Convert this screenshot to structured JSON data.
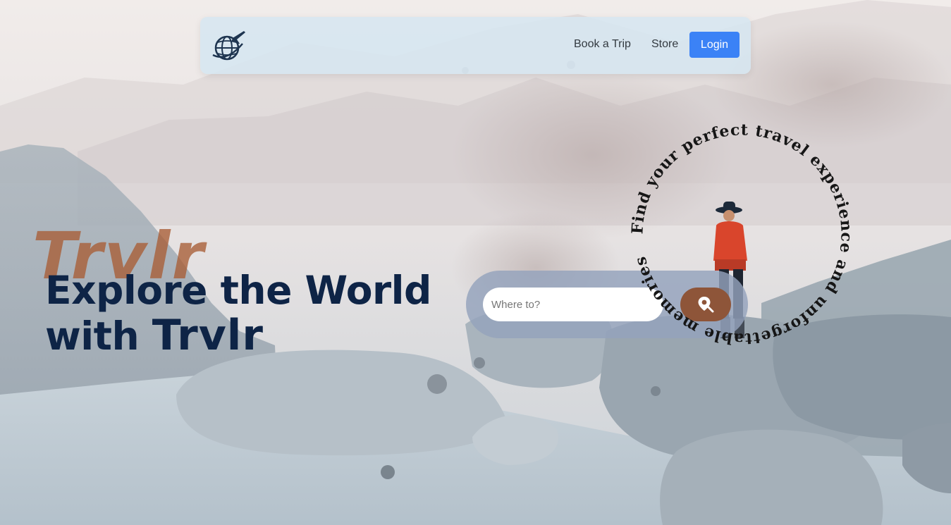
{
  "nav": {
    "logo_icon": "globe-airplane-icon",
    "links": [
      {
        "label": "Book a Trip"
      },
      {
        "label": "Store"
      }
    ],
    "login_label": "Login"
  },
  "hero": {
    "watermark": "Trvlr",
    "title_line1": "Explore the World",
    "title_line2_prefix": "with ",
    "title_brand": "Trvlr"
  },
  "search": {
    "placeholder": "Where to?",
    "button_icon": "location-search-icon"
  },
  "circular_text": "Find your perfect travel experience and unforgettable memories",
  "colors": {
    "accent": "#3b82f6",
    "title": "#0e2446",
    "brand_rust": "#8e5539",
    "navbar_bg": "#d6e6f0"
  }
}
